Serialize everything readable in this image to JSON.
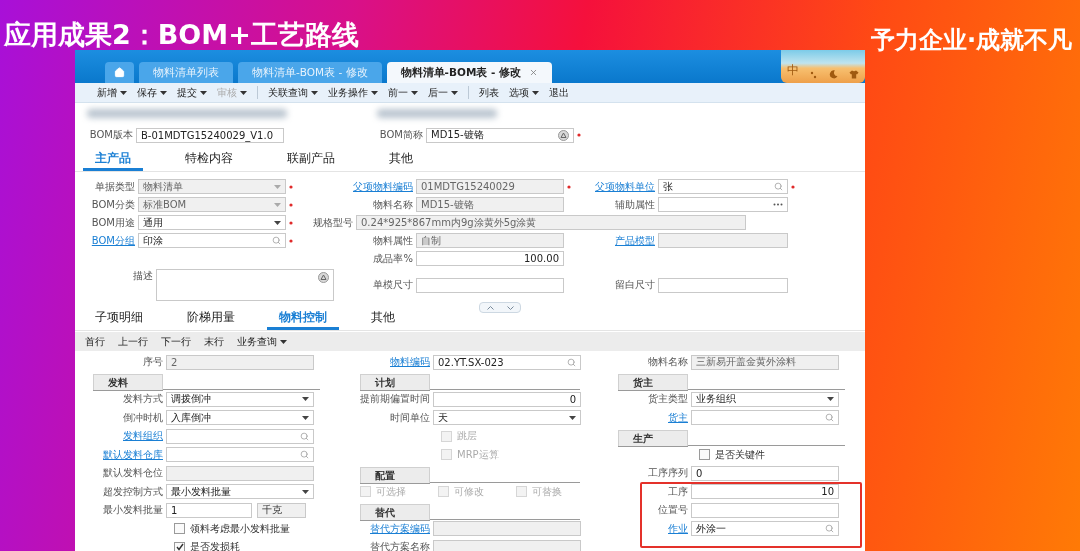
{
  "slide_title": "应用成果2：BOM+工艺路线",
  "slogan": "予力企业·成就不凡",
  "tabs": [
    {
      "kind": "home",
      "selected": false
    },
    {
      "kind": "text",
      "label": "物料清单列表",
      "selected": false
    },
    {
      "kind": "text",
      "label": "物料清单-BOM表 - 修改",
      "selected": false
    },
    {
      "kind": "text",
      "label": "物料清单-BOM表 - 修改",
      "selected": true,
      "closable": true
    }
  ],
  "ime_mode": "中",
  "toolbar": [
    {
      "label": "新增",
      "dropdown": true,
      "disabled": false
    },
    {
      "label": "保存",
      "dropdown": true,
      "disabled": false
    },
    {
      "label": "提交",
      "dropdown": true,
      "disabled": false
    },
    {
      "label": "审核",
      "dropdown": true,
      "disabled": true,
      "separator_after": true
    },
    {
      "label": "关联查询",
      "dropdown": true,
      "disabled": false
    },
    {
      "label": "业务操作",
      "dropdown": true,
      "disabled": false
    },
    {
      "label": "前一",
      "dropdown": true,
      "disabled": false
    },
    {
      "label": "后一",
      "dropdown": true,
      "disabled": false,
      "separator_after": true
    },
    {
      "label": "列表",
      "dropdown": false,
      "disabled": false
    },
    {
      "label": "选项",
      "dropdown": true,
      "disabled": false
    },
    {
      "label": "退出",
      "dropdown": false,
      "disabled": false
    }
  ],
  "header_fields": [
    {
      "label": "BOM版本",
      "value": "B-01MDTG15240029_V1.0",
      "kind": "text",
      "disabled": false
    },
    {
      "label": "BOM简称",
      "value": "MD15-镀铬",
      "kind": "lookup",
      "disabled": false,
      "required": true
    }
  ],
  "main_tabs": [
    {
      "label": "主产品",
      "selected": true
    },
    {
      "label": "特检内容",
      "selected": false
    },
    {
      "label": "联副产品",
      "selected": false
    },
    {
      "label": "其他",
      "selected": false
    }
  ],
  "main_form": {
    "rows": [
      {
        "left": {
          "label": "单据类型",
          "value": "物料清单",
          "kind": "dropdown",
          "disabled": true,
          "required": true,
          "link": false
        },
        "middle": {
          "label": "父项物料编码",
          "value": "01MDTG15240029",
          "kind": "text",
          "disabled": true,
          "required": true,
          "link": true
        },
        "right": {
          "label": "父项物料单位",
          "value": "张",
          "kind": "search",
          "disabled": false,
          "required": true,
          "link": true
        }
      },
      {
        "left": {
          "label": "BOM分类",
          "value": "标准BOM",
          "kind": "dropdown",
          "disabled": true,
          "required": true,
          "link": false
        },
        "middle": {
          "label": "物料名称",
          "value": "MD15-镀铬",
          "kind": "text",
          "disabled": true,
          "link": false
        },
        "right": {
          "label": "辅助属性",
          "kind": "ellipsis",
          "disabled": false,
          "link": false
        }
      },
      {
        "left": {
          "label": "BOM用途",
          "value": "通用",
          "kind": "dropdown",
          "disabled": false,
          "required": true,
          "link": false
        },
        "wide": {
          "label": "规格型号",
          "value": "0.24*925*867mm内9g涂黄外5g涂黄",
          "kind": "text",
          "disabled": true,
          "link": false
        }
      },
      {
        "left": {
          "label": "BOM分组",
          "value": "印涂",
          "kind": "search",
          "disabled": false,
          "required": true,
          "link": true
        },
        "middle": {
          "label": "物料属性",
          "value": "自制",
          "kind": "text",
          "disabled": true,
          "link": false
        },
        "right": {
          "label": "产品模型",
          "kind": "text",
          "disabled": true,
          "link": true
        }
      },
      {
        "middle": {
          "label": "成品率%",
          "value": "100.00",
          "kind": "number",
          "disabled": false,
          "link": false
        }
      },
      {
        "left": {
          "label": "描述",
          "kind": "textarea",
          "disabled": false,
          "link": false
        },
        "middle": {
          "label": "单模尺寸",
          "kind": "text",
          "disabled": false,
          "link": false
        },
        "right": {
          "label": "留白尺寸",
          "kind": "text",
          "disabled": false,
          "link": false
        }
      }
    ]
  },
  "detail_tabs": [
    {
      "label": "子项明细",
      "selected": false
    },
    {
      "label": "阶梯用量",
      "selected": false
    },
    {
      "label": "物料控制",
      "selected": true
    },
    {
      "label": "其他",
      "selected": false
    }
  ],
  "detail_toolbar": [
    {
      "label": "首行",
      "dropdown": false
    },
    {
      "label": "上一行",
      "dropdown": false
    },
    {
      "label": "下一行",
      "dropdown": false
    },
    {
      "label": "末行",
      "dropdown": false
    },
    {
      "label": "业务查询",
      "dropdown": true
    }
  ],
  "detail_form": {
    "columns": [
      [
        {
          "kind": "text",
          "label": "序号",
          "value": "2",
          "disabled": true,
          "link": false
        },
        {
          "kind": "section",
          "label": "发料"
        },
        {
          "kind": "dropdown",
          "label": "发料方式",
          "value": "调拨倒冲",
          "disabled": false,
          "link": false
        },
        {
          "kind": "dropdown",
          "label": "倒冲时机",
          "value": "入库倒冲",
          "disabled": false,
          "link": false
        },
        {
          "kind": "search",
          "label": "发料组织",
          "disabled": false,
          "link": true
        },
        {
          "kind": "search",
          "label": "默认发料仓库",
          "disabled": false,
          "link": true
        },
        {
          "kind": "text",
          "label": "默认发料仓位",
          "disabled": true,
          "link": false
        },
        {
          "kind": "dropdown",
          "label": "超发控制方式",
          "value": "最小发料批量",
          "disabled": false,
          "link": false
        },
        {
          "kind": "text",
          "label": "最小发料批量",
          "value": "1",
          "unit": "千克",
          "disabled": false,
          "link": false
        },
        {
          "kind": "checkbox",
          "label": "领料考虑最小发料批量",
          "checked": false,
          "disabled": false
        },
        {
          "kind": "checkbox",
          "label": "是否发损耗",
          "checked": true,
          "disabled": false
        }
      ],
      [
        {
          "kind": "search",
          "label": "物料编码",
          "value": "02.YT.SX-023",
          "disabled": false,
          "link": true
        },
        {
          "kind": "section",
          "label": "计划"
        },
        {
          "kind": "number",
          "label": "提前期偏置时间",
          "value": "0",
          "disabled": false,
          "link": false
        },
        {
          "kind": "dropdown",
          "label": "时间单位",
          "value": "天",
          "disabled": false,
          "link": false
        },
        {
          "kind": "checkbox",
          "label": "跳层",
          "checked": false,
          "disabled": true
        },
        {
          "kind": "checkbox",
          "label": "MRP运算",
          "checked": false,
          "disabled": true
        },
        {
          "kind": "section",
          "label": "配置"
        },
        {
          "kind": "checkbox_row",
          "items": [
            {
              "label": "可选择",
              "checked": false,
              "disabled": true
            },
            {
              "label": "可修改",
              "checked": false,
              "disabled": true
            },
            {
              "label": "可替换",
              "checked": false,
              "disabled": true
            }
          ]
        },
        {
          "kind": "section",
          "label": "替代"
        },
        {
          "kind": "text",
          "label": "替代方案编码",
          "disabled": true,
          "link": true
        },
        {
          "kind": "text",
          "label": "替代方案名称",
          "disabled": true,
          "link": false
        }
      ],
      [
        {
          "kind": "text",
          "label": "物料名称",
          "value": "三新易开盖金黄外涂料",
          "disabled": true,
          "link": false
        },
        {
          "kind": "section",
          "label": "货主"
        },
        {
          "kind": "dropdown",
          "label": "货主类型",
          "value": "业务组织",
          "disabled": false,
          "link": false
        },
        {
          "kind": "search",
          "label": "货主",
          "disabled": false,
          "link": true
        },
        {
          "kind": "section",
          "label": "生产"
        },
        {
          "kind": "checkbox",
          "label": "是否关键件",
          "checked": false,
          "disabled": false
        },
        {
          "kind": "text",
          "label": "工序序列",
          "value": "0",
          "disabled": false,
          "link": false
        },
        {
          "kind": "number",
          "label": "工序",
          "value": "10",
          "disabled": false,
          "link": false
        },
        {
          "kind": "text",
          "label": "位置号",
          "disabled": false,
          "link": false
        },
        {
          "kind": "search",
          "label": "作业",
          "value": "外涂一",
          "disabled": false,
          "link": true
        }
      ]
    ]
  }
}
